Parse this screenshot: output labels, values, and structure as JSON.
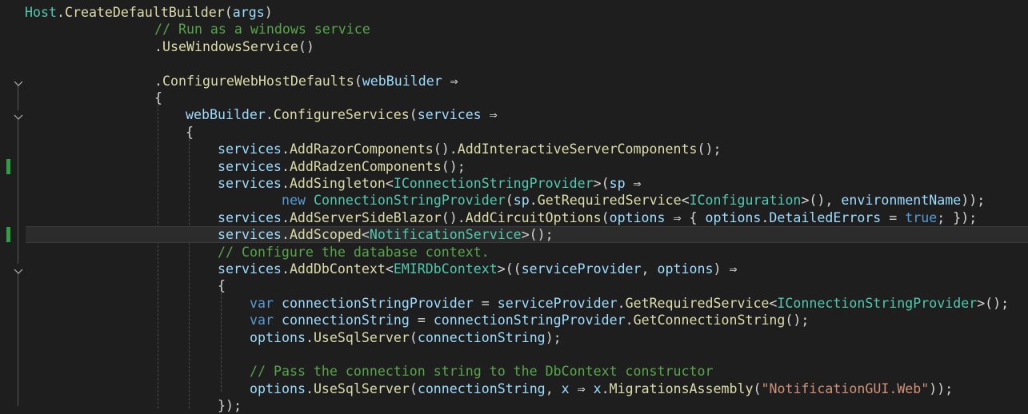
{
  "editor": {
    "lines": [
      {
        "tokens": [
          [
            "Host",
            "type"
          ],
          [
            ".",
            "punct"
          ],
          [
            "CreateDefaultBuilder",
            "method"
          ],
          [
            "(",
            "punct"
          ],
          [
            "args",
            "param"
          ],
          [
            ")",
            "punct"
          ]
        ]
      },
      {
        "tokens": [
          [
            "// Run as a windows service",
            "comment"
          ]
        ]
      },
      {
        "tokens": [
          [
            ".",
            "punct"
          ],
          [
            "UseWindowsService",
            "method"
          ],
          [
            "()",
            "punct"
          ]
        ]
      },
      {
        "tokens": []
      },
      {
        "tokens": [
          [
            ".",
            "punct"
          ],
          [
            "ConfigureWebHostDefaults",
            "method"
          ],
          [
            "(",
            "punct"
          ],
          [
            "webBuilder",
            "param"
          ],
          [
            " ⇒",
            "punct"
          ]
        ]
      },
      {
        "tokens": [
          [
            "{",
            "punct"
          ]
        ]
      },
      {
        "tokens": [
          [
            "webBuilder",
            "param"
          ],
          [
            ".",
            "punct"
          ],
          [
            "ConfigureServices",
            "method"
          ],
          [
            "(",
            "punct"
          ],
          [
            "services",
            "param"
          ],
          [
            " ⇒",
            "punct"
          ]
        ]
      },
      {
        "tokens": [
          [
            "{",
            "punct"
          ]
        ]
      },
      {
        "tokens": [
          [
            "services",
            "param"
          ],
          [
            ".",
            "punct"
          ],
          [
            "AddRazorComponents",
            "method"
          ],
          [
            "().",
            "punct"
          ],
          [
            "AddInteractiveServerComponents",
            "method"
          ],
          [
            "();",
            "punct"
          ]
        ]
      },
      {
        "tokens": [
          [
            "services",
            "param"
          ],
          [
            ".",
            "punct"
          ],
          [
            "AddRadzenComponents",
            "method"
          ],
          [
            "();",
            "punct"
          ]
        ]
      },
      {
        "tokens": [
          [
            "services",
            "param"
          ],
          [
            ".",
            "punct"
          ],
          [
            "AddSingleton",
            "method"
          ],
          [
            "<",
            "punct"
          ],
          [
            "IConnectionStringProvider",
            "type"
          ],
          [
            ">(",
            "punct"
          ],
          [
            "sp",
            "param"
          ],
          [
            " ⇒",
            "punct"
          ]
        ]
      },
      {
        "tokens": [
          [
            "new ",
            "keyword"
          ],
          [
            "ConnectionStringProvider",
            "type"
          ],
          [
            "(",
            "punct"
          ],
          [
            "sp",
            "param"
          ],
          [
            ".",
            "punct"
          ],
          [
            "GetRequiredService",
            "method"
          ],
          [
            "<",
            "punct"
          ],
          [
            "IConfiguration",
            "type"
          ],
          [
            ">(), ",
            "punct"
          ],
          [
            "environmentName",
            "ident"
          ],
          [
            "));",
            "punct"
          ]
        ]
      },
      {
        "tokens": [
          [
            "services",
            "param"
          ],
          [
            ".",
            "punct"
          ],
          [
            "AddServerSideBlazor",
            "method"
          ],
          [
            "().",
            "punct"
          ],
          [
            "AddCircuitOptions",
            "method"
          ],
          [
            "(",
            "punct"
          ],
          [
            "options",
            "param"
          ],
          [
            " ⇒ { ",
            "punct"
          ],
          [
            "options",
            "param"
          ],
          [
            ".",
            "punct"
          ],
          [
            "DetailedErrors",
            "ident"
          ],
          [
            " = ",
            "punct"
          ],
          [
            "true",
            "keyword"
          ],
          [
            "; });",
            "punct"
          ]
        ]
      },
      {
        "tokens": [
          [
            "services",
            "param"
          ],
          [
            ".",
            "punct"
          ],
          [
            "AddScoped",
            "method"
          ],
          [
            "<",
            "punct"
          ],
          [
            "NotificationService",
            "type"
          ],
          [
            ">();",
            "punct"
          ]
        ]
      },
      {
        "tokens": [
          [
            "// Configure the database context.",
            "comment"
          ]
        ]
      },
      {
        "tokens": [
          [
            "services",
            "param"
          ],
          [
            ".",
            "punct"
          ],
          [
            "AddDbContext",
            "method"
          ],
          [
            "<",
            "punct"
          ],
          [
            "EMIRDbContext",
            "type"
          ],
          [
            ">((",
            "punct"
          ],
          [
            "serviceProvider",
            "param"
          ],
          [
            ", ",
            "punct"
          ],
          [
            "options",
            "param"
          ],
          [
            ") ⇒",
            "punct"
          ]
        ]
      },
      {
        "tokens": [
          [
            "{",
            "punct"
          ]
        ]
      },
      {
        "tokens": [
          [
            "var ",
            "keyword"
          ],
          [
            "connectionStringProvider",
            "ident"
          ],
          [
            " = ",
            "punct"
          ],
          [
            "serviceProvider",
            "param"
          ],
          [
            ".",
            "punct"
          ],
          [
            "GetRequiredService",
            "method"
          ],
          [
            "<",
            "punct"
          ],
          [
            "IConnectionStringProvider",
            "type"
          ],
          [
            ">();",
            "punct"
          ]
        ]
      },
      {
        "tokens": [
          [
            "var ",
            "keyword"
          ],
          [
            "connectionString",
            "ident"
          ],
          [
            " = ",
            "punct"
          ],
          [
            "connectionStringProvider",
            "ident"
          ],
          [
            ".",
            "punct"
          ],
          [
            "GetConnectionString",
            "method"
          ],
          [
            "();",
            "punct"
          ]
        ]
      },
      {
        "tokens": [
          [
            "options",
            "param"
          ],
          [
            ".",
            "punct"
          ],
          [
            "UseSqlServer",
            "method"
          ],
          [
            "(",
            "punct"
          ],
          [
            "connectionString",
            "ident"
          ],
          [
            ");",
            "punct"
          ]
        ]
      },
      {
        "tokens": []
      },
      {
        "tokens": [
          [
            "// Pass the connection string to the DbContext constructor",
            "comment"
          ]
        ]
      },
      {
        "tokens": [
          [
            "options",
            "param"
          ],
          [
            ".",
            "punct"
          ],
          [
            "UseSqlServer",
            "method"
          ],
          [
            "(",
            "punct"
          ],
          [
            "connectionString",
            "ident"
          ],
          [
            ", ",
            "punct"
          ],
          [
            "x",
            "param"
          ],
          [
            " ⇒ ",
            "punct"
          ],
          [
            "x",
            "param"
          ],
          [
            ".",
            "punct"
          ],
          [
            "MigrationsAssembly",
            "method"
          ],
          [
            "(",
            "punct"
          ],
          [
            "\"NotificationGUI.Web\"",
            "string"
          ],
          [
            "));",
            "punct"
          ]
        ]
      },
      {
        "tokens": [
          [
            "});",
            "punct"
          ]
        ]
      }
    ],
    "current_line": 13,
    "changed_lines": [
      9,
      13
    ],
    "fold_lines": [
      4,
      6,
      15
    ]
  },
  "colors": {
    "background": "#1e1e1e",
    "current_line": "#2c2c2c",
    "change_marker": "#2ea043"
  }
}
